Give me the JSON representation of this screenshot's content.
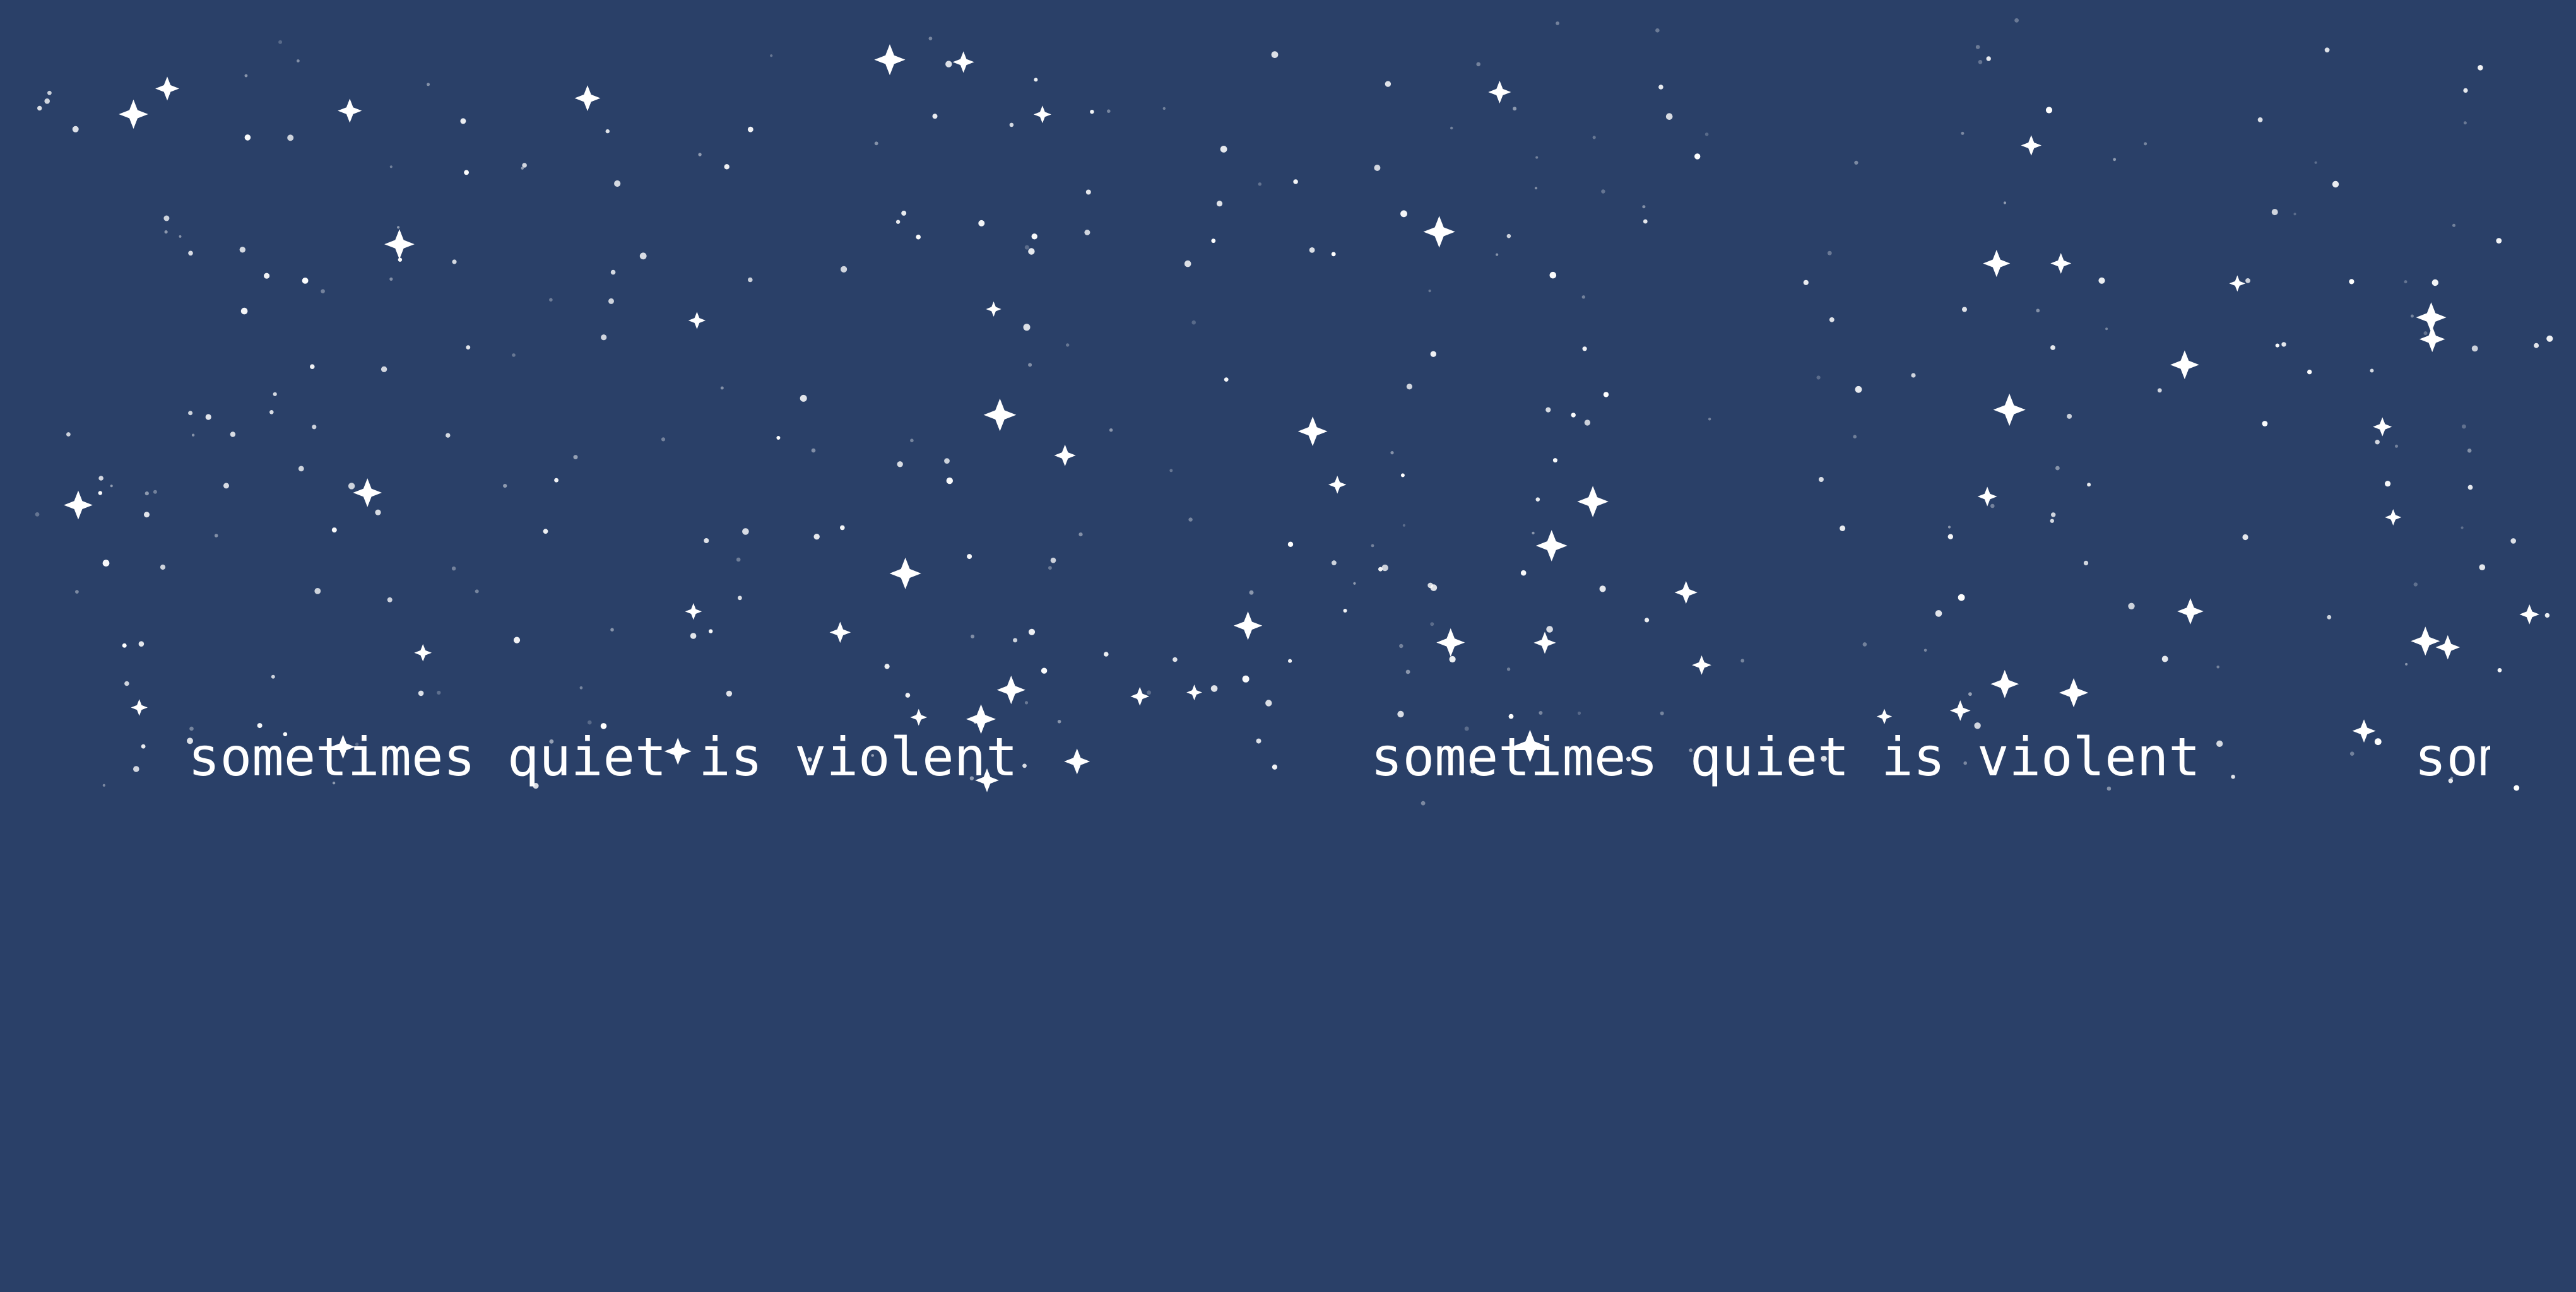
{
  "scene": {
    "background_color": "#2a4068",
    "star_color": "#ffffff",
    "marquee": {
      "text": "sometimes quiet is violent"
    }
  }
}
